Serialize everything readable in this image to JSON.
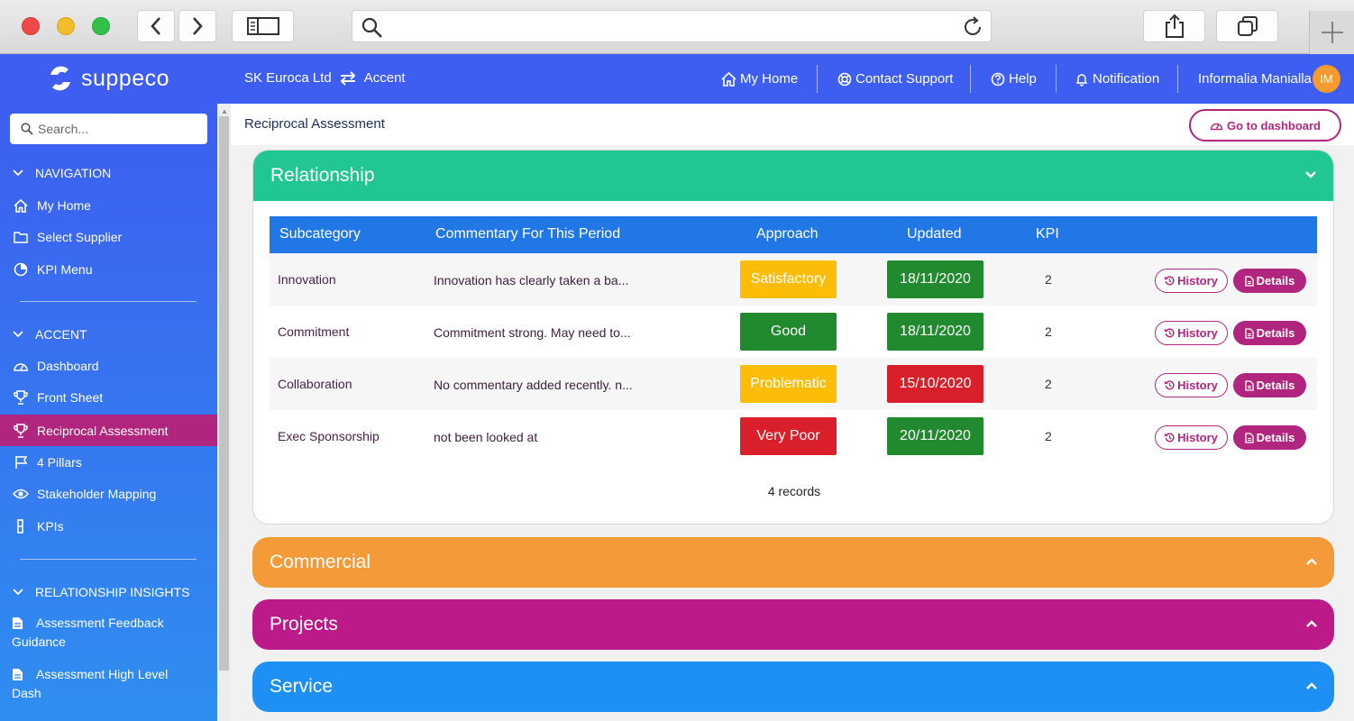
{
  "colors": {
    "brand_blue": "#3d5ef0",
    "accent_magenta": "#b0257e",
    "relationship": "#22c693",
    "commercial": "#f49a38",
    "projects": "#bd1a89",
    "service": "#1e90f5",
    "table_header": "#2277e6",
    "status_satisfactory": "#fbbd08",
    "status_good": "#21892e",
    "status_problematic": "#fbbd08",
    "status_very_poor": "#d81f2a",
    "date_green": "#21892e",
    "date_red": "#d81f2a"
  },
  "header": {
    "logo_text": "suppeco",
    "company": "SK Euroca Ltd",
    "context": "Accent",
    "nav": [
      {
        "label": "My Home",
        "icon": "home-icon"
      },
      {
        "label": "Contact Support",
        "icon": "lifebuoy-icon"
      },
      {
        "label": "Help",
        "icon": "question-circle-icon"
      },
      {
        "label": "Notification",
        "icon": "bell-icon"
      }
    ],
    "user_name": "Informalia Manialla",
    "user_initials": "IM"
  },
  "sidebar": {
    "search_placeholder": "Search...",
    "sections": [
      {
        "title": "NAVIGATION",
        "items": [
          {
            "label": "My Home",
            "icon": "home-icon"
          },
          {
            "label": "Select Supplier",
            "icon": "folder-icon"
          },
          {
            "label": "KPI Menu",
            "icon": "pie-chart-icon"
          }
        ]
      },
      {
        "title": "ACCENT",
        "items": [
          {
            "label": "Dashboard",
            "icon": "gauge-icon"
          },
          {
            "label": "Front Sheet",
            "icon": "trophy-icon"
          },
          {
            "label": "Reciprocal Assessment",
            "icon": "trophy-icon",
            "active": true
          },
          {
            "label": "4 Pillars",
            "icon": "flag-icon"
          },
          {
            "label": "Stakeholder Mapping",
            "icon": "eye-icon"
          },
          {
            "label": "KPIs",
            "icon": "bar-icon"
          }
        ]
      },
      {
        "title": "RELATIONSHIP INSIGHTS",
        "items": [
          {
            "label": "Assessment Feedback Guidance",
            "icon": "document-icon"
          },
          {
            "label": "Assessment High Level Dash",
            "icon": "document-icon"
          }
        ]
      }
    ]
  },
  "main": {
    "breadcrumb": "Reciprocal Assessment",
    "dashboard_button": "Go to dashboard",
    "panels": [
      "Relationship",
      "Commercial",
      "Projects",
      "Service"
    ],
    "table": {
      "columns": [
        "Subcategory",
        "Commentary For This Period",
        "Approach",
        "Updated",
        "KPI"
      ],
      "rows": [
        {
          "subcategory": "Innovation",
          "commentary": "Innovation has clearly taken a ba...",
          "approach": "Satisfactory",
          "updated": "18/11/2020",
          "kpi": "2"
        },
        {
          "subcategory": "Commitment",
          "commentary": "Commitment strong. May need to...",
          "approach": "Good",
          "updated": "18/11/2020",
          "kpi": "2"
        },
        {
          "subcategory": "Collaboration",
          "commentary": "No commentary added recently. n...",
          "approach": "Problematic",
          "updated": "15/10/2020",
          "kpi": "2"
        },
        {
          "subcategory": "Exec Sponsorship",
          "commentary": "not been looked at",
          "approach": "Very Poor",
          "updated": "20/11/2020",
          "kpi": "2"
        }
      ],
      "history_label": "History",
      "details_label": "Details",
      "records": "4 records"
    }
  }
}
